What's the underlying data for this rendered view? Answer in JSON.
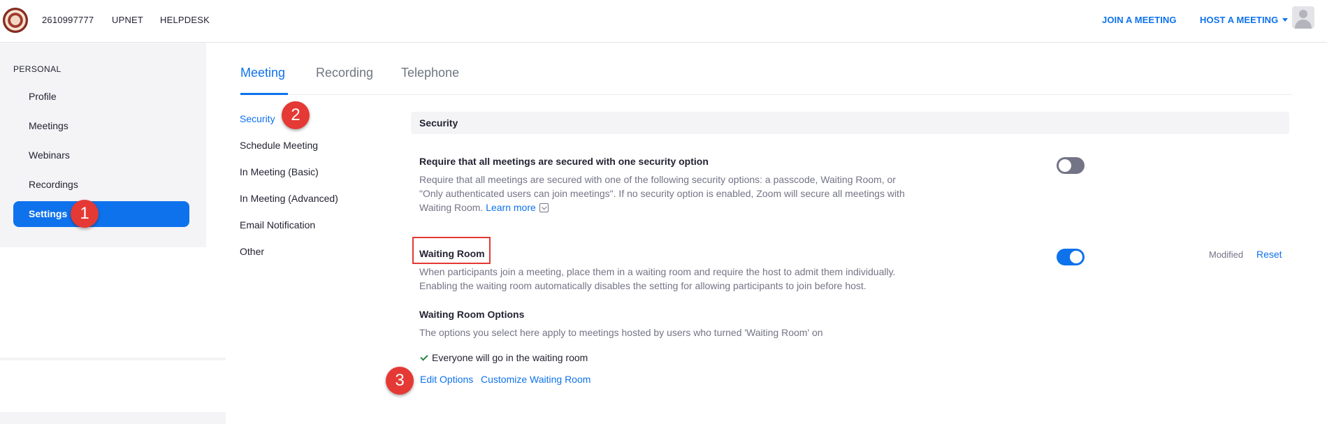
{
  "topbar": {
    "phone": "2610997777",
    "upnet": "UPNET",
    "helpdesk": "HELPDESK",
    "join_meeting": "JOIN A MEETING",
    "host_meeting": "HOST A MEETING"
  },
  "sidebar": {
    "heading": "PERSONAL",
    "items": [
      {
        "label": "Profile"
      },
      {
        "label": "Meetings"
      },
      {
        "label": "Webinars"
      },
      {
        "label": "Recordings"
      },
      {
        "label": "Settings",
        "active": true
      }
    ]
  },
  "tabs": [
    {
      "label": "Meeting",
      "active": true
    },
    {
      "label": "Recording"
    },
    {
      "label": "Telephone"
    }
  ],
  "subnav": [
    {
      "label": "Security",
      "active": true
    },
    {
      "label": "Schedule Meeting"
    },
    {
      "label": "In Meeting (Basic)"
    },
    {
      "label": "In Meeting (Advanced)"
    },
    {
      "label": "Email Notification"
    },
    {
      "label": "Other"
    }
  ],
  "section": {
    "title": "Security",
    "require_secure": {
      "title": "Require that all meetings are secured with one security option",
      "desc_line1": "Require that all meetings are secured with one of the following security options: a passcode, Waiting Room, or",
      "desc_line2": "\"Only authenticated users can join meetings\". If no security option is enabled, Zoom will secure all meetings with",
      "desc_line3": "Waiting Room.",
      "learn_more": "Learn more",
      "enabled": false
    },
    "waiting_room": {
      "title": "Waiting Room",
      "desc_line1": "When participants join a meeting, place them in a waiting room and require the host to admit them individually.",
      "desc_line2": "Enabling the waiting room automatically disables the setting for allowing participants to join before host.",
      "enabled": true,
      "modified": "Modified",
      "reset": "Reset",
      "options_title": "Waiting Room Options",
      "options_desc": "The options you select here apply to meetings hosted by users who turned 'Waiting Room' on",
      "option_selected": "Everyone will go in the waiting room",
      "edit_options": "Edit Options",
      "customize": "Customize Waiting Room"
    }
  },
  "annotations": [
    "1",
    "2",
    "3"
  ],
  "colors": {
    "accent": "#0e72ed",
    "badge": "#e53935",
    "toggle_off": "#747487"
  }
}
